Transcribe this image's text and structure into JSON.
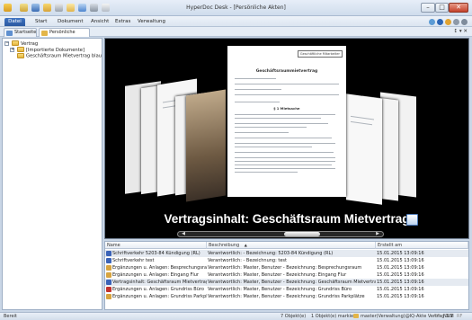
{
  "window": {
    "title": "HyperDoc Desk - [Persönliche Akten]",
    "controls": {
      "minimize": "–",
      "maximize": "□",
      "close": "✕"
    }
  },
  "menu": {
    "tabs": [
      "Datei",
      "Start",
      "Dokument",
      "Ansicht",
      "Extras",
      "Verwaltung"
    ]
  },
  "doc_tabs": {
    "items": [
      "Startseite",
      "Persönliche Akten"
    ],
    "controls": "↕ ▾ ✕"
  },
  "tree": {
    "root": {
      "label": "Vertrag",
      "expander": "−"
    },
    "children": [
      {
        "label": "[Importierte Dokumente]",
        "expander": "+"
      },
      {
        "label": "Geschäftsraum Mietvertrag blau"
      }
    ]
  },
  "viewer": {
    "caption": "Vertragsinhalt: Geschäftsraum Mietvertrag",
    "page_title": "Geschäftsraummietvertrag",
    "stamp": "Geschäftliche Mitarbeiter",
    "section": "§ 1 Mietsache",
    "scroll_left": "◀",
    "scroll_right": "▶"
  },
  "table": {
    "headers": [
      "Name",
      "Beschreibung",
      "Erstellt am"
    ],
    "sort_indicator": "▲",
    "rows": [
      {
        "name": "Schriftverkehr 5203-84 Kündigung (RL)",
        "desc": "Verantwortlich: - Bezeichnung: 5203-84 Kündigung (RL)",
        "date": "15.01.2015 13:09:16",
        "selected": true,
        "icon_color": "#3a63b8"
      },
      {
        "name": "Schriftverkehr test",
        "desc": "Verantwortlich: - Bezeichnung: test",
        "date": "15.01.2015 13:09:16",
        "selected": false,
        "icon_color": "#3a63b8"
      },
      {
        "name": "Ergänzungen u. Anlagen: Besprechungsraum",
        "desc": "Verantwortlich: Master, Benutzer - Bezeichnung: Besprechungsraum",
        "date": "15.01.2015 13:09:16",
        "selected": false,
        "icon_color": "#d7a440"
      },
      {
        "name": "Ergänzungen u. Anlagen: Eingang Flur",
        "desc": "Verantwortlich: Master, Benutzer - Bezeichnung: Eingang Flur",
        "date": "15.01.2015 13:09:16",
        "selected": false,
        "icon_color": "#d7a440"
      },
      {
        "name": "Vertragsinhalt: Geschäftsraum Mietvertrag",
        "desc": "Verantwortlich: Master, Benutzer - Bezeichnung: Geschäftsraum Mietvertrag",
        "date": "15.01.2015 13:09:16",
        "selected": true,
        "icon_color": "#3a63b8"
      },
      {
        "name": "Ergänzungen u. Anlagen: Grundriss Büro",
        "desc": "Verantwortlich: Master, Benutzer - Bezeichnung: Grundriss Büro",
        "date": "15.01.2015 13:09:16",
        "selected": false,
        "icon_color": "#c2322d"
      },
      {
        "name": "Ergänzungen u. Anlagen: Grundriss Parkplätze",
        "desc": "Verantwortlich: Master, Benutzer - Bezeichnung: Grundriss Parkplätze",
        "date": "15.01.2015 13:09:16",
        "selected": false,
        "icon_color": "#d7a440"
      }
    ]
  },
  "status": {
    "left": "Bereit",
    "objects": "7 Objekt(e)",
    "marked": "1 Objekt(e) markiert",
    "path": "master(Verwaltung)@IQ-Akte Vertrag 3.1",
    "caps": "UF",
    "num": "NUM",
    "scrl": "RF"
  },
  "colors": {
    "accent": "#2a58a0",
    "selection": "#e5eaf1"
  }
}
